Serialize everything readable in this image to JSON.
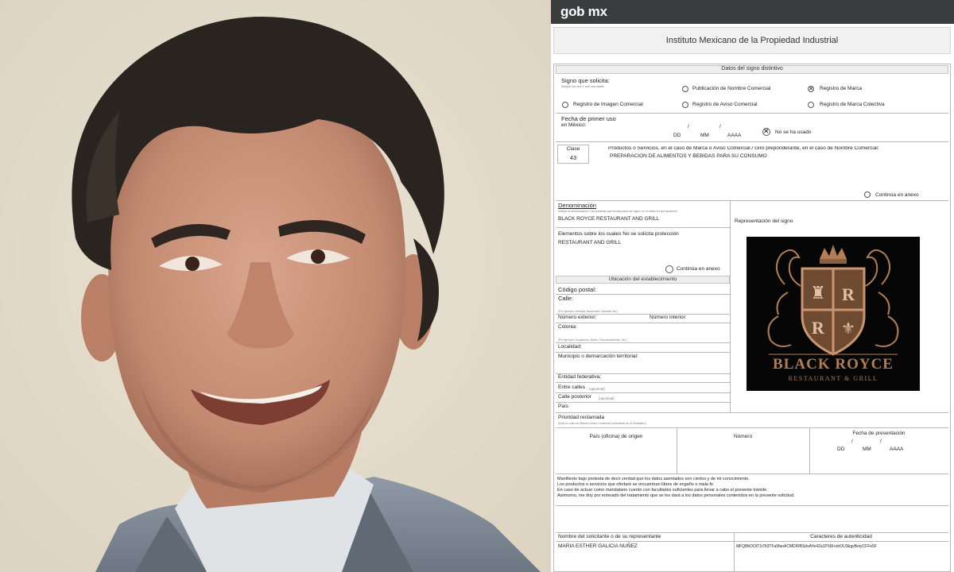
{
  "header": {
    "brand": "gob mx"
  },
  "institute": "Instituto Mexicano de la Propiedad Industrial",
  "section_sign": "Datos del signo distintivo",
  "signo": {
    "label": "Signo que solicita:",
    "hint": "Marque con una X solo una casilla",
    "options": [
      {
        "label": "Publicación de Nombre Comercial",
        "checked": false
      },
      {
        "label": "Registro de Marca",
        "checked": true
      },
      {
        "label": "Registro de Imagen Comercial",
        "checked": false
      },
      {
        "label": "Registro de Aviso Comercial",
        "checked": false
      },
      {
        "label": "Registro de Marca Colectiva",
        "checked": false
      }
    ]
  },
  "first_use": {
    "label": "Fecha de primer uso",
    "sublabel": "en México:",
    "dd": "DD",
    "mm": "MM",
    "aaaa": "AAAA",
    "not_used": "No se ha usado",
    "not_used_checked": true
  },
  "clase": {
    "label": "Clase",
    "value": "43"
  },
  "products": {
    "label": "Productos o Servicios, en el caso de Marca o Aviso Comercial / Giro preponderante, en el caso de Nombre Comercial:",
    "value": "PREPARACION DE ALIMENTOS Y BEBIDAS PARA SU CONSUMO",
    "continua": "Continúa en anexo"
  },
  "denominacion": {
    "label": "Denominación",
    "hint": "Indique la denominación o las palabras que forman parte del signo, en el orden en que aparecen.",
    "value": "BLACK ROYCE RESTAURANT AND GRILL"
  },
  "elementos": {
    "label": "Elementos sobre los cuales No se solicita protección",
    "value": "RESTAURANT AND GRILL",
    "continua": "Continúa en anexo"
  },
  "representacion_label": "Representación del signo",
  "logo": {
    "line1": "BLACK ROYCE",
    "line2": "RESTAURANT & GRILL",
    "gold": "#b07d55",
    "bg": "#060606"
  },
  "ubicacion": {
    "title": "Ubicación del establecimiento",
    "codigo_postal": "Código postal:",
    "calle": "Calle:",
    "calle_hint": "(Por ejemplo: Avenida, Boulevard, Calzada, etc.)",
    "num_ext": "Número exterior:",
    "num_int": "Número interior:",
    "colonia": "Colonia:",
    "colonia_hint": "(Por ejemplo: Ampliación, Barrio, Fraccionamiento, etc.)",
    "localidad": "Localidad:",
    "municipio": "Municipio o demarcación territorial:",
    "entidad": "Entidad federativa:",
    "entre": "Entre calles",
    "entre_opt": "(opcional)",
    "posterior": "Calle posterior",
    "posterior_opt": "(opcional)",
    "pais": "País"
  },
  "prioridad": {
    "label": "Prioridad reclamada",
    "hint": "(Sólo en caso de Marca o Aviso Comercial presentado en el extranjero)",
    "pais_origen": "País (oficina) de origen",
    "numero": "Número",
    "fecha": "Fecha de presentación",
    "dd": "DD",
    "mm": "MM",
    "aaaa": "AAAA"
  },
  "declaraciones": [
    "Manifiesto bajo protesta de decir verdad que los datos asentados son ciertos y de mi conocimiento.",
    "Los productos o servicios que ofertaré se encuentran libres de engaño o mala fe.",
    "En caso de actuar como mandatario cuento con facultades suficientes para llevar a cabo el presente trámite.",
    "Asimismo, me doy por enterado del tratamiento que se les dará a los datos personales contenidos en la presente solicitud."
  ],
  "solicitante": {
    "label": "Nombre del solicitante o de su representante",
    "value": "MARIA ESTHER GALICIA NUÑEZ"
  },
  "autenticidad": {
    "label": "Caracteres de autenticidad",
    "value": "MFQlBtOOtT1t7lt3TFa9faoACMD/RBSdvAYe42a1PXl8+dxOUSkgvBeiyCFFe5F"
  }
}
